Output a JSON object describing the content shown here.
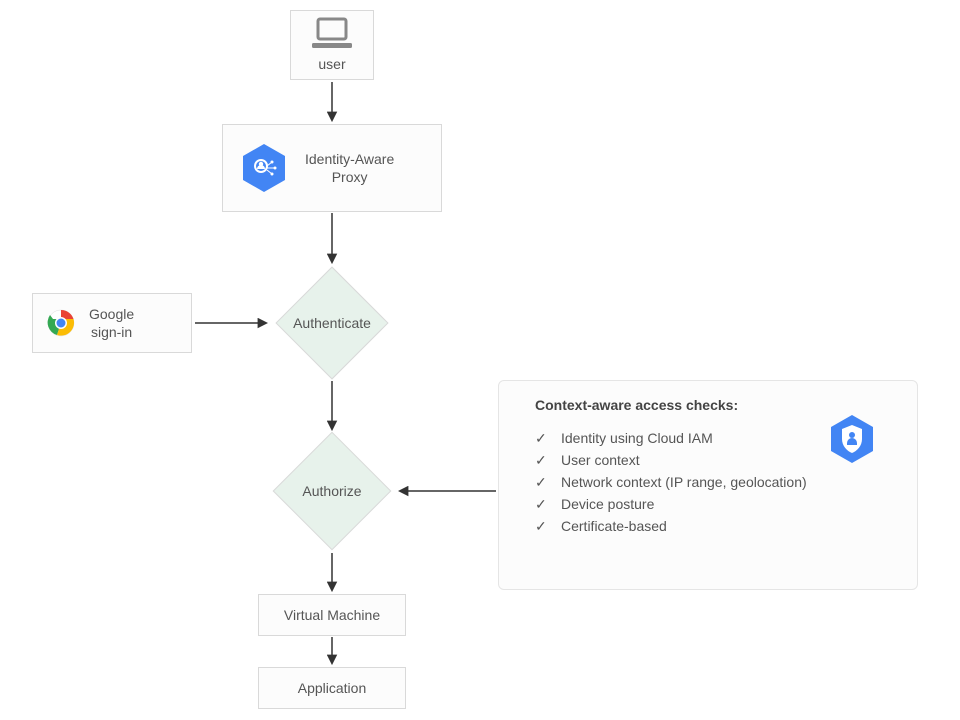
{
  "nodes": {
    "user": "user",
    "iap": "Identity-Aware\nProxy",
    "signin": "Google\nsign-in",
    "authenticate": "Authenticate",
    "authorize": "Authorize",
    "vm": "Virtual Machine",
    "app": "Application"
  },
  "checks": {
    "title": "Context-aware access checks:",
    "items": [
      "Identity using Cloud IAM",
      "User context",
      "Network context (IP range, geolocation)",
      "Device posture",
      "Certificate-based"
    ]
  },
  "colors": {
    "hex_blue": "#4285F4",
    "diamond_fill": "#e7f2eb",
    "border": "#d9d9d9"
  }
}
